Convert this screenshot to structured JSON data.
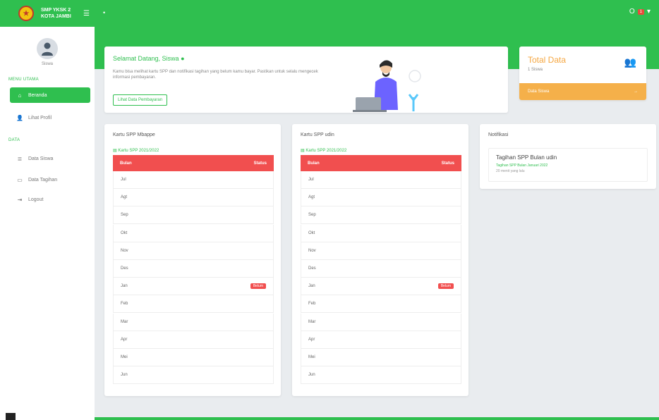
{
  "header": {
    "school_name": "SMP YKSK 2 KOTA JAMBI",
    "user_initials": "O",
    "notification_badge": "1"
  },
  "sidebar": {
    "user_name": "Siswa",
    "section_main": "MENU UTAMA",
    "section_data": "DATA",
    "items": [
      {
        "label": "Beranda",
        "icon": "home-icon"
      },
      {
        "label": "Lihat Profil",
        "icon": "user-icon"
      },
      {
        "label": "Data Siswa",
        "icon": "list-icon"
      },
      {
        "label": "Data Tagihan",
        "icon": "calendar-icon"
      },
      {
        "label": "Logout",
        "icon": "logout-icon"
      }
    ]
  },
  "welcome": {
    "title": "Selamat Datang, Siswa",
    "description": "Kamu bisa melihat kartu SPP dan notifikasi tagihan yang belum kamu bayar. Pastikan untuk selalu mengecek informasi pembayaran.",
    "button_label": "Lihat Data Pembayaran"
  },
  "total_card": {
    "title": "Total Data",
    "subtitle": "1 Siswa",
    "footer_label": "Data Siswa",
    "footer_arrow": "→"
  },
  "kartu_cards": [
    {
      "title": "Kartu SPP Mbappe",
      "subtitle": "Kartu SPP 2021/2022",
      "col_month": "Bulan",
      "col_status": "Status",
      "rows": [
        {
          "month": "Jul",
          "status": ""
        },
        {
          "month": "Agt",
          "status": ""
        },
        {
          "month": "Sep",
          "status": ""
        },
        {
          "month": "Okt",
          "status": ""
        },
        {
          "month": "Nov",
          "status": ""
        },
        {
          "month": "Des",
          "status": ""
        },
        {
          "month": "Jan",
          "status": "Belum"
        },
        {
          "month": "Feb",
          "status": ""
        },
        {
          "month": "Mar",
          "status": ""
        },
        {
          "month": "Apr",
          "status": ""
        },
        {
          "month": "Mei",
          "status": ""
        },
        {
          "month": "Jun",
          "status": ""
        }
      ]
    },
    {
      "title": "Kartu SPP udin",
      "subtitle": "Kartu SPP 2021/2022",
      "col_month": "Bulan",
      "col_status": "Status",
      "rows": [
        {
          "month": "Jul",
          "status": ""
        },
        {
          "month": "Agt",
          "status": ""
        },
        {
          "month": "Sep",
          "status": ""
        },
        {
          "month": "Okt",
          "status": ""
        },
        {
          "month": "Nov",
          "status": ""
        },
        {
          "month": "Des",
          "status": ""
        },
        {
          "month": "Jan",
          "status": "Belum"
        },
        {
          "month": "Feb",
          "status": ""
        },
        {
          "month": "Mar",
          "status": ""
        },
        {
          "month": "Apr",
          "status": ""
        },
        {
          "month": "Mei",
          "status": ""
        },
        {
          "month": "Jun",
          "status": ""
        }
      ]
    }
  ],
  "notifikasi": {
    "title": "Notifikasi",
    "item_title": "Tagihan SPP Bulan udin",
    "item_desc": "Tagihan SPP Bulan Januari 2022",
    "item_time": "20 menit yang lalu"
  },
  "colors": {
    "primary": "#2fbf4f",
    "danger": "#f14f4f",
    "warning": "#f5b04a"
  }
}
